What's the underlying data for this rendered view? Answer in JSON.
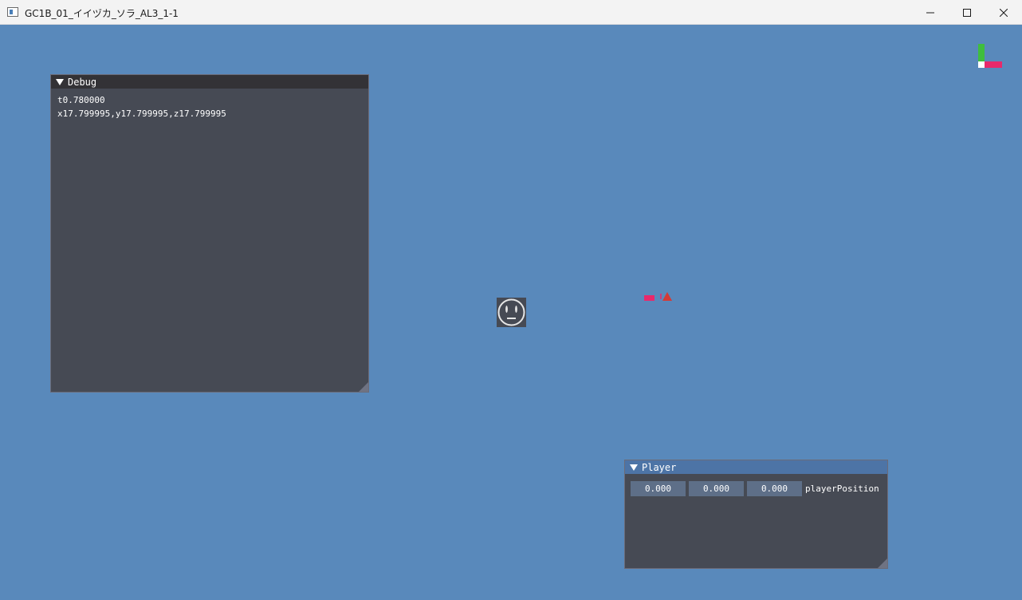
{
  "window": {
    "title": "GC1B_01_イイヅカ_ソラ_AL3_1-1",
    "icon": "app-window-icon",
    "controls": [
      "minimize-icon",
      "maximize-icon",
      "close-icon"
    ]
  },
  "debug_panel": {
    "title": "Debug",
    "lines": [
      "t0.780000",
      "x17.799995,y17.799995,z17.799995"
    ]
  },
  "player_panel": {
    "title": "Player",
    "fields": [
      "0.000",
      "0.000",
      "0.000"
    ],
    "field_label": "playerPosition"
  },
  "scene": {
    "background_color": "#5989bb",
    "axis_gizmo_colors": {
      "y": "#3fbe3e",
      "x": "#e8296b",
      "origin": "#ffffff"
    },
    "player_sprite": "face-icon",
    "enemy_colors": {
      "body": "#e8296b",
      "marker": "#d43a36"
    }
  }
}
